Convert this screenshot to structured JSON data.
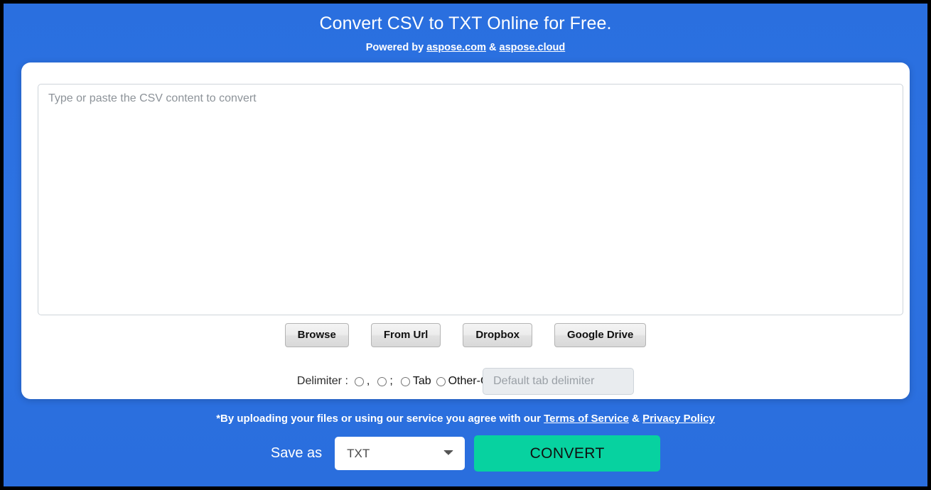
{
  "header": {
    "title": "Convert CSV to TXT Online for Free.",
    "powered_by_prefix": "Powered by ",
    "link1": "aspose.com",
    "ampersand": " & ",
    "link2": "aspose.cloud"
  },
  "editor": {
    "placeholder": "Type or paste the CSV content to convert",
    "value": ""
  },
  "sources": [
    {
      "label": "Browse"
    },
    {
      "label": "From Url"
    },
    {
      "label": "Dropbox"
    },
    {
      "label": "Google Drive"
    }
  ],
  "delimiter": {
    "label": "Delimiter :",
    "options": [
      {
        "label": ",",
        "selected": false
      },
      {
        "label": ";",
        "selected": false
      },
      {
        "label": "Tab",
        "selected": false
      },
      {
        "label": "Other-Choose",
        "selected": false
      }
    ],
    "custom_input": {
      "placeholder": "Default tab delimiter",
      "value": "",
      "disabled": true
    }
  },
  "terms": {
    "text_before": "*By uploading your files or using our service you agree with our ",
    "terms_link": "Terms of Service",
    "separator": " & ",
    "privacy_link": "Privacy Policy"
  },
  "footer": {
    "save_as_label": "Save as",
    "selected_format": "TXT",
    "format_options": [
      "TXT"
    ],
    "convert_label": "CONVERT"
  },
  "colors": {
    "background_blue": "#2a6fdf",
    "accent_green": "#07d2a0",
    "card_white": "#ffffff",
    "frame_black": "#000000"
  }
}
